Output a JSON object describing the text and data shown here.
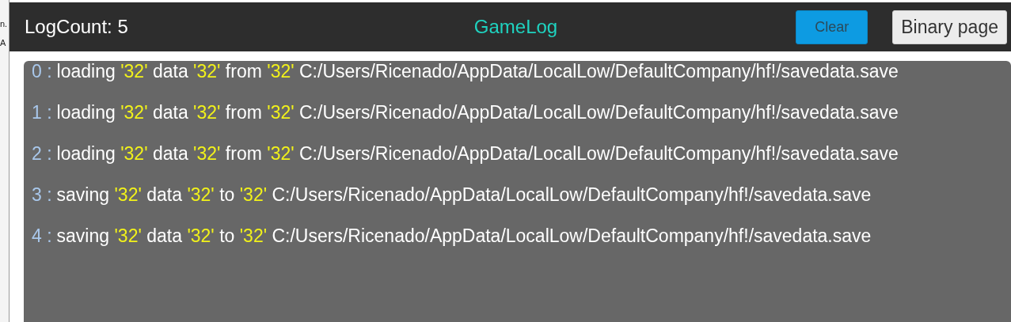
{
  "side_window": {
    "texts": [
      "n.",
      "A"
    ]
  },
  "header": {
    "log_count": "LogCount: 5",
    "title": "GameLog",
    "buttons": [
      {
        "label": "Clear",
        "kind": "primary"
      },
      {
        "label": "Binary page",
        "kind": "secondary"
      }
    ]
  },
  "logs": [
    {
      "index": "0 :",
      "parts": [
        {
          "text": "loading ",
          "highlighted": false
        },
        {
          "text": "'32'",
          "highlighted": true
        },
        {
          "text": " data ",
          "highlighted": false
        },
        {
          "text": "'32'",
          "highlighted": true
        },
        {
          "text": " from ",
          "highlighted": false
        },
        {
          "text": "'32'",
          "highlighted": true
        },
        {
          "text": " C:/Users/Ricenado/AppData/LocalLow/DefaultCompany/hf!/savedata.save",
          "highlighted": false
        }
      ]
    },
    {
      "index": "1 :",
      "parts": [
        {
          "text": "loading ",
          "highlighted": false
        },
        {
          "text": "'32'",
          "highlighted": true
        },
        {
          "text": " data ",
          "highlighted": false
        },
        {
          "text": "'32'",
          "highlighted": true
        },
        {
          "text": " from ",
          "highlighted": false
        },
        {
          "text": "'32'",
          "highlighted": true
        },
        {
          "text": " C:/Users/Ricenado/AppData/LocalLow/DefaultCompany/hf!/savedata.save",
          "highlighted": false
        }
      ]
    },
    {
      "index": "2 :",
      "parts": [
        {
          "text": "loading ",
          "highlighted": false
        },
        {
          "text": "'32'",
          "highlighted": true
        },
        {
          "text": " data ",
          "highlighted": false
        },
        {
          "text": "'32'",
          "highlighted": true
        },
        {
          "text": " from ",
          "highlighted": false
        },
        {
          "text": "'32'",
          "highlighted": true
        },
        {
          "text": " C:/Users/Ricenado/AppData/LocalLow/DefaultCompany/hf!/savedata.save",
          "highlighted": false
        }
      ]
    },
    {
      "index": "3 :",
      "parts": [
        {
          "text": "saving ",
          "highlighted": false
        },
        {
          "text": "'32'",
          "highlighted": true
        },
        {
          "text": " data ",
          "highlighted": false
        },
        {
          "text": "'32'",
          "highlighted": true
        },
        {
          "text": " to ",
          "highlighted": false
        },
        {
          "text": "'32'",
          "highlighted": true
        },
        {
          "text": " C:/Users/Ricenado/AppData/LocalLow/DefaultCompany/hf!/savedata.save",
          "highlighted": false
        }
      ]
    },
    {
      "index": "4 :",
      "parts": [
        {
          "text": "saving ",
          "highlighted": false
        },
        {
          "text": "'32'",
          "highlighted": true
        },
        {
          "text": " data ",
          "highlighted": false
        },
        {
          "text": "'32'",
          "highlighted": true
        },
        {
          "text": " to ",
          "highlighted": false
        },
        {
          "text": "'32'",
          "highlighted": true
        },
        {
          "text": " C:/Users/Ricenado/AppData/LocalLow/DefaultCompany/hf!/savedata.save",
          "highlighted": false
        }
      ]
    }
  ]
}
